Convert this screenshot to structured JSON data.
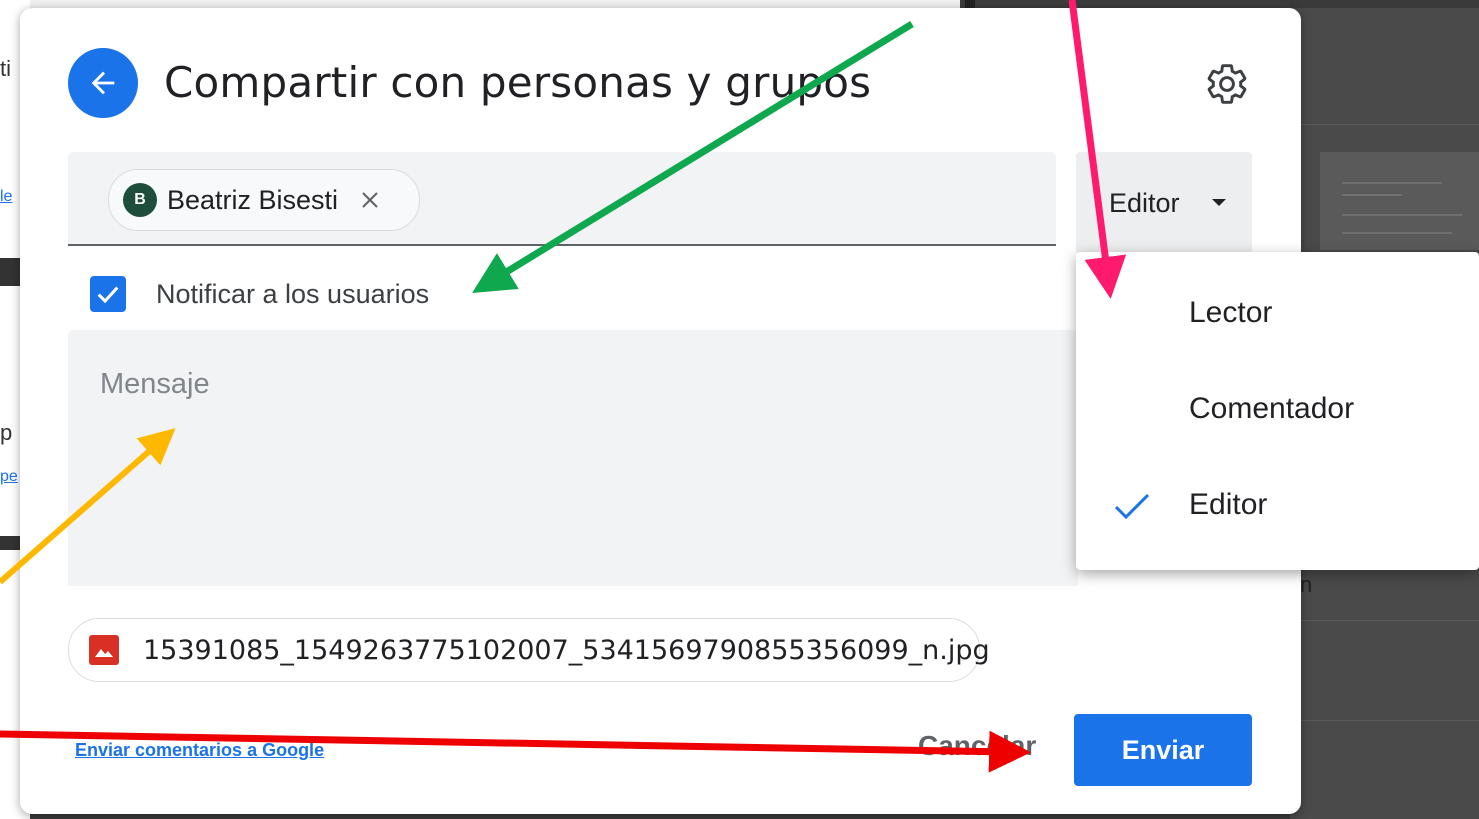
{
  "dialog": {
    "title": "Compartir con personas y grupos",
    "back_icon": "arrow-left-icon",
    "settings_icon": "gear-icon"
  },
  "recipient": {
    "initial": "B",
    "name": "Beatriz Bisesti",
    "remove_icon": "close-icon"
  },
  "role": {
    "selected": "Editor",
    "caret_icon": "caret-down-icon",
    "options": [
      "Lector",
      "Comentador",
      "Editor"
    ]
  },
  "notify": {
    "label": "Notificar a los usuarios",
    "checked": true
  },
  "message": {
    "placeholder": "Mensaje"
  },
  "attachment": {
    "filename": "15391085_1549263775102007_5341569790855356099_n.jpg",
    "icon": "image-file-icon"
  },
  "footer": {
    "feedback_link": "Enviar comentarios a Google",
    "cancel_label": "Cancelar",
    "send_label": "Enviar"
  },
  "colors": {
    "accent": "#1a73e8",
    "arrow_green": "#0fa84f",
    "arrow_pink": "#ff1a6e",
    "arrow_yellow": "#ffb800",
    "arrow_red": "#ee0000"
  }
}
